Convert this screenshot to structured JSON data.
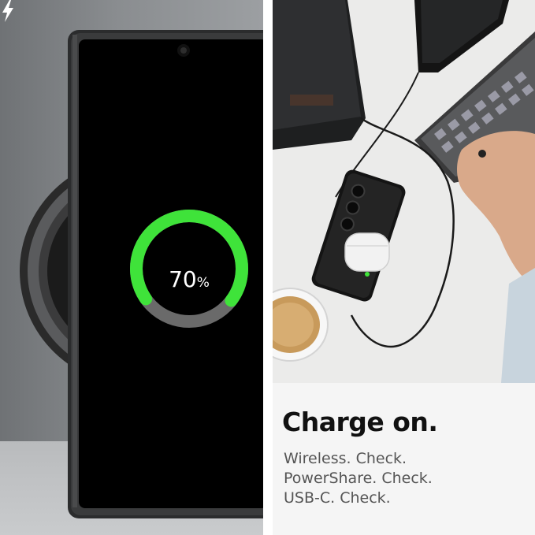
{
  "phone_screen": {
    "battery_percent_value": "70",
    "battery_percent_unit": "%",
    "battery_level": 0.7,
    "ring_color": "#3fe33a",
    "ring_track_color": "#6a6a6a",
    "icon": "lightning-bolt-icon"
  },
  "text_panel": {
    "headline": "Charge on.",
    "features": [
      "Wireless. Check.",
      "PowerShare. Check.",
      "USB-C. Check."
    ]
  },
  "colors": {
    "headline": "#111111",
    "body_text": "#555555"
  }
}
